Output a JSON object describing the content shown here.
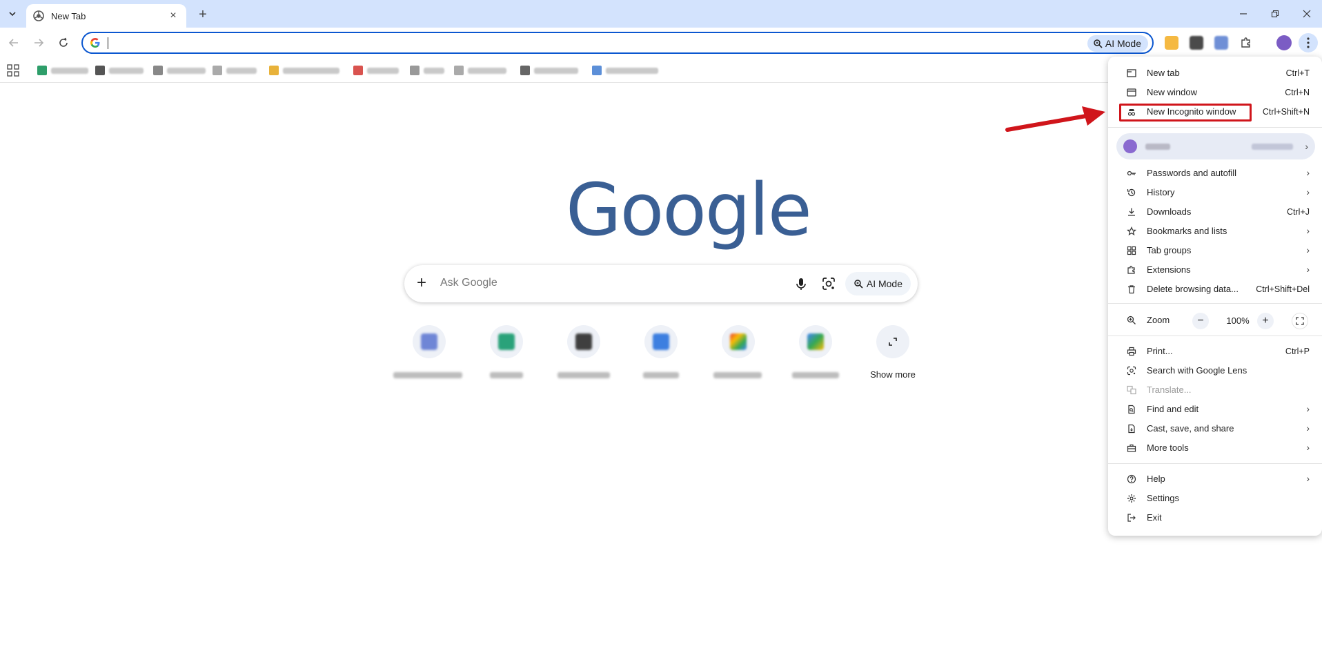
{
  "tab": {
    "title": "New Tab"
  },
  "omnibox": {
    "ai_mode_label": "AI Mode"
  },
  "search": {
    "placeholder": "Ask Google",
    "ai_mode_label": "AI Mode"
  },
  "logo": {
    "text": "Google"
  },
  "shortcuts": {
    "show_more_label": "Show more"
  },
  "menu": {
    "new_tab": {
      "label": "New tab",
      "shortcut": "Ctrl+T"
    },
    "new_window": {
      "label": "New window",
      "shortcut": "Ctrl+N"
    },
    "new_incognito": {
      "label": "New Incognito window",
      "shortcut": "Ctrl+Shift+N"
    },
    "passwords": {
      "label": "Passwords and autofill"
    },
    "history": {
      "label": "History"
    },
    "downloads": {
      "label": "Downloads",
      "shortcut": "Ctrl+J"
    },
    "bookmarks": {
      "label": "Bookmarks and lists"
    },
    "tab_groups": {
      "label": "Tab groups"
    },
    "extensions": {
      "label": "Extensions"
    },
    "delete_data": {
      "label": "Delete browsing data...",
      "shortcut": "Ctrl+Shift+Del"
    },
    "zoom": {
      "label": "Zoom",
      "value": "100%"
    },
    "print": {
      "label": "Print...",
      "shortcut": "Ctrl+P"
    },
    "lens": {
      "label": "Search with Google Lens"
    },
    "translate": {
      "label": "Translate..."
    },
    "find_edit": {
      "label": "Find and edit"
    },
    "cast": {
      "label": "Cast, save, and share"
    },
    "more_tools": {
      "label": "More tools"
    },
    "help": {
      "label": "Help"
    },
    "settings": {
      "label": "Settings"
    },
    "exit": {
      "label": "Exit"
    }
  },
  "colors": {
    "accent": "#0b57d0",
    "titlebar": "#d3e3fd",
    "highlight": "#d0151b",
    "logo": "#3a5f94"
  }
}
